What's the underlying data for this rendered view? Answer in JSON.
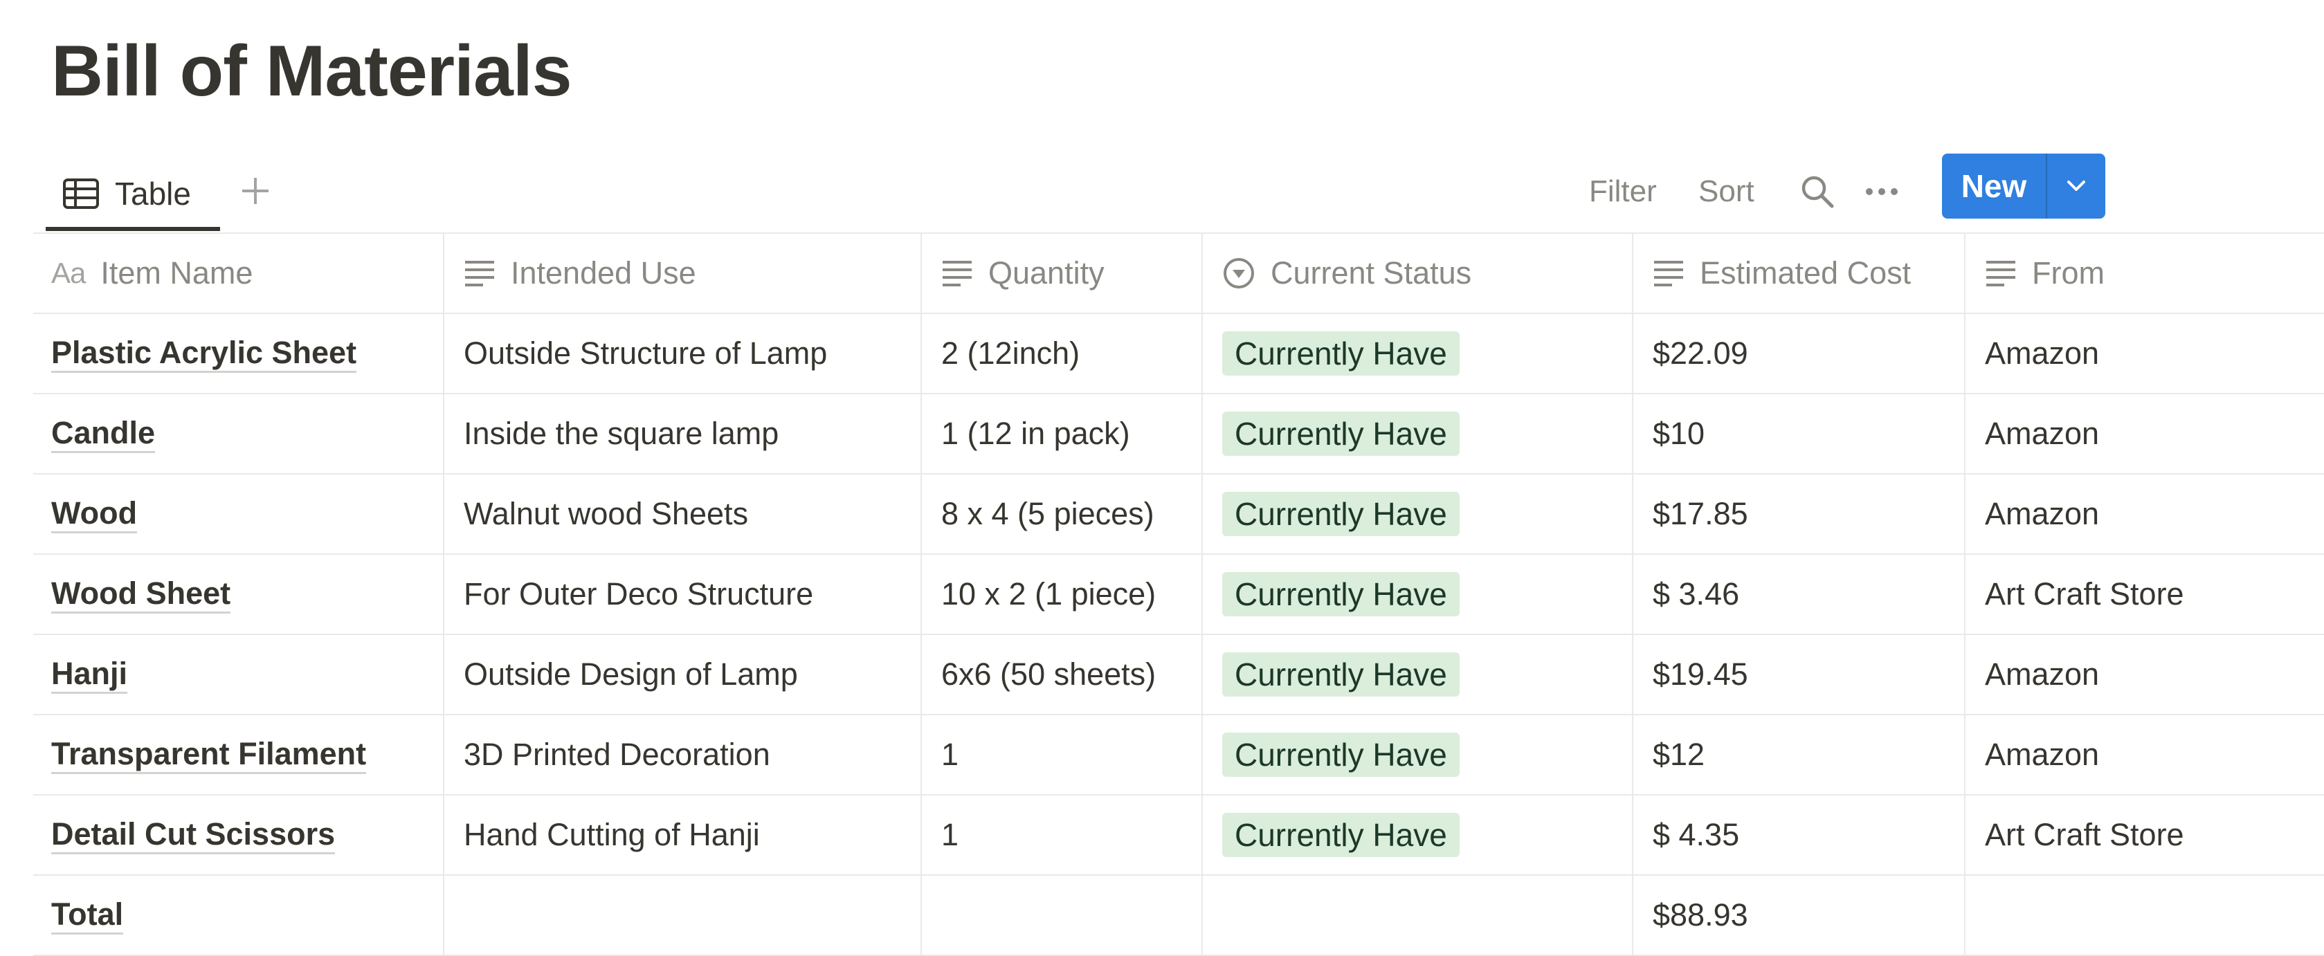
{
  "page": {
    "title": "Bill of Materials"
  },
  "views": {
    "tabs": [
      {
        "label": "Table",
        "icon": "table-icon"
      }
    ],
    "add_icon": "plus-icon"
  },
  "toolbar": {
    "filter_label": "Filter",
    "sort_label": "Sort",
    "search_icon": "search-icon",
    "more_icon": "more-icon",
    "new_label": "New",
    "new_caret_icon": "chevron-down-icon",
    "accent_color": "#2f80e0"
  },
  "table": {
    "columns": [
      {
        "label": "Item Name",
        "icon": "title-aa-icon"
      },
      {
        "label": "Intended Use",
        "icon": "text-property-icon"
      },
      {
        "label": "Quantity",
        "icon": "text-property-icon"
      },
      {
        "label": "Current Status",
        "icon": "status-icon"
      },
      {
        "label": "Estimated Cost",
        "icon": "text-property-icon"
      },
      {
        "label": "From",
        "icon": "text-property-icon"
      }
    ],
    "rows": [
      {
        "name": "Plastic Acrylic Sheet",
        "use": "Outside Structure of Lamp",
        "qty": "2 (12inch)",
        "status": "Currently Have",
        "cost": "$22.09",
        "from": "Amazon"
      },
      {
        "name": "Candle",
        "use": "Inside the square lamp",
        "qty": "1 (12 in pack)",
        "status": "Currently Have",
        "cost": "$10",
        "from": "Amazon"
      },
      {
        "name": "Wood",
        "use": "Walnut wood Sheets",
        "qty": "8 x 4 (5 pieces)",
        "status": "Currently Have",
        "cost": "$17.85",
        "from": "Amazon"
      },
      {
        "name": "Wood Sheet",
        "use": "For Outer Deco Structure",
        "qty": "10 x 2 (1 piece)",
        "status": "Currently Have",
        "cost": "$ 3.46",
        "from": "Art Craft Store"
      },
      {
        "name": "Hanji",
        "use": "Outside Design of Lamp",
        "qty": "6x6 (50 sheets)",
        "status": "Currently Have",
        "cost": "$19.45",
        "from": "Amazon"
      },
      {
        "name": "Transparent Filament",
        "use": "3D Printed Decoration",
        "qty": "1",
        "status": "Currently Have",
        "cost": "$12",
        "from": "Amazon"
      },
      {
        "name": "Detail Cut Scissors",
        "use": "Hand Cutting of Hanji",
        "qty": "1",
        "status": "Currently Have",
        "cost": "$ 4.35",
        "from": "Art Craft Store"
      },
      {
        "name": "Total",
        "use": "",
        "qty": "",
        "status": "",
        "cost": "$88.93",
        "from": ""
      }
    ],
    "status_color": "#dbeddb"
  }
}
